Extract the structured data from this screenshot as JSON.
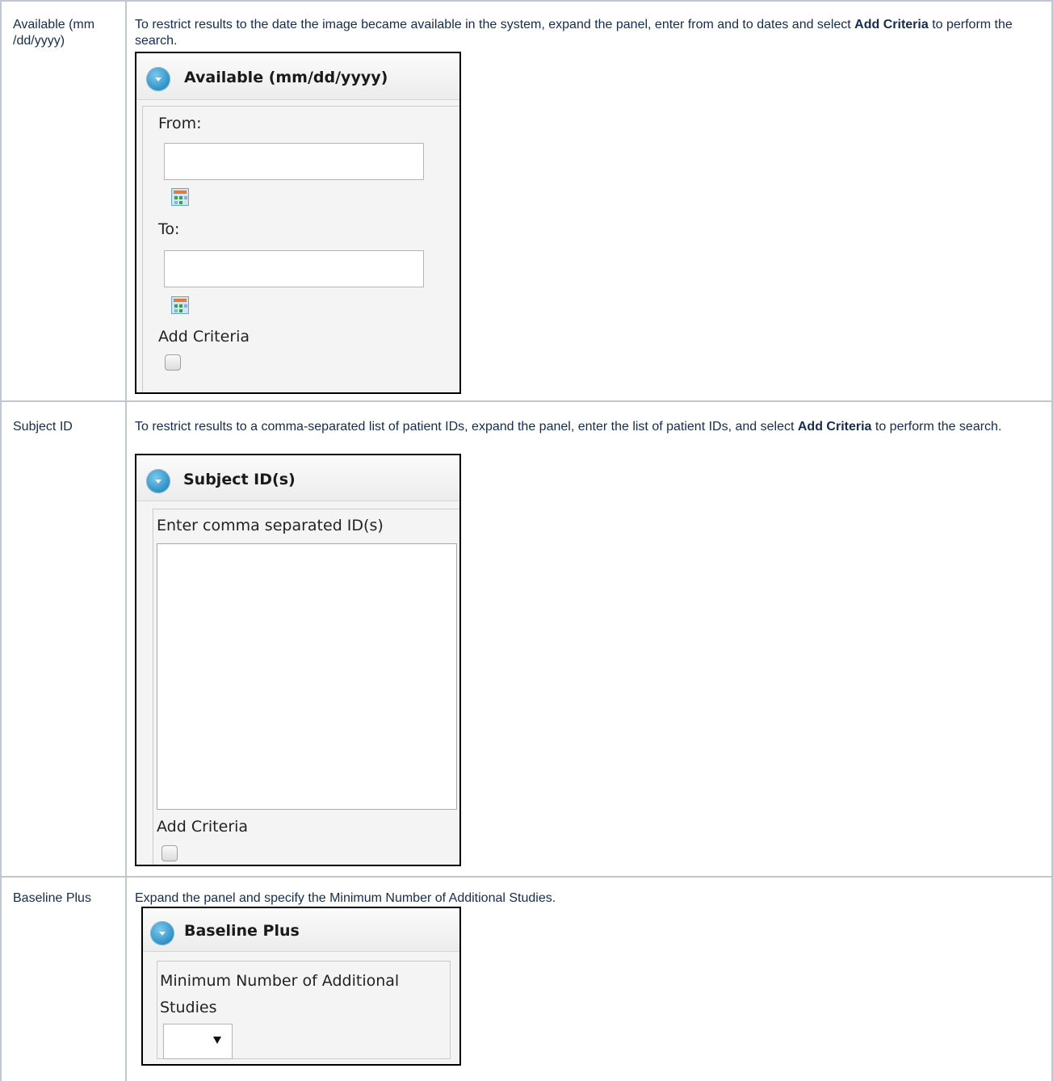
{
  "rows": [
    {
      "label": "Available (mm /dd/yyyy)",
      "desc_before": "To restrict results to the date the image became available in the system, expand the panel, enter from and to dates and select ",
      "desc_bold": "Add Criteria",
      "desc_after": " to perform the search.",
      "panel": {
        "title": "Available (mm/dd/yyyy)",
        "from_label": "From:",
        "from_value": "",
        "to_label": "To:",
        "to_value": "",
        "add_criteria_label": "Add Criteria",
        "add_criteria_checked": false
      }
    },
    {
      "label": "Subject ID",
      "desc_before": "To restrict results to a comma-separated list of patient IDs, expand the panel, enter the list of patient IDs, and select ",
      "desc_bold": "Add Criteria",
      "desc_after": " to perform the search.",
      "panel": {
        "title": "Subject ID(s)",
        "ids_label": "Enter comma separated ID(s)",
        "ids_value": "",
        "add_criteria_label": "Add Criteria",
        "add_criteria_checked": false
      }
    },
    {
      "label": "Baseline Plus",
      "desc": "Expand the panel and specify the Minimum Number of Additional Studies.",
      "panel": {
        "title": "Baseline Plus",
        "min_label": "Minimum Number of Additional Studies",
        "min_selected": ""
      }
    }
  ]
}
